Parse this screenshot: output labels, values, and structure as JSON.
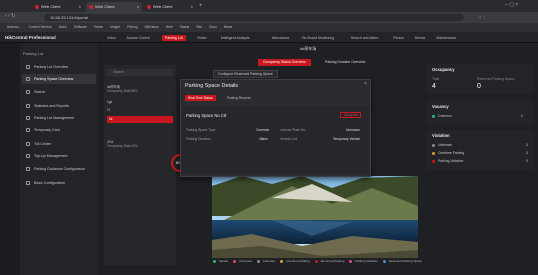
{
  "browser": {
    "tabs": [
      {
        "label": "Web Client"
      },
      {
        "label": "Web Client"
      },
      {
        "label": "Web Client"
      }
    ],
    "url": "10.66.25.131/#/portal",
    "bookmarks": [
      "Arduino...",
      "Control Service",
      "Dash",
      "Software",
      "Home",
      "Insight",
      "Pairing",
      "HikVision",
      "Web",
      "Status",
      "Site",
      "Docs",
      "News"
    ]
  },
  "app": {
    "logo": "HikCentral Professional",
    "menu": [
      "Video",
      "Access Control",
      "Parking Lot",
      "Visitor",
      "Intelligent Analysis",
      "Attendance",
      "On-Board Monitoring",
      "Search and Alarm",
      "Person",
      "Device",
      "Maintenance"
    ],
    "active_menu": "Parking Lot"
  },
  "sidebar": {
    "header": "Parking Lot",
    "items": [
      {
        "label": "Parking Lot Overview"
      },
      {
        "label": "Parking Space Overview"
      },
      {
        "label": "Search"
      },
      {
        "label": "Statistics and Reports"
      },
      {
        "label": "Parking Lot Management"
      },
      {
        "label": "Temporary Card"
      },
      {
        "label": "Toll Center"
      },
      {
        "label": "Top-Up Management"
      },
      {
        "label": "Parking Guidance Configuration"
      },
      {
        "label": "Basic Configuration"
      }
    ]
  },
  "main": {
    "breadcrumb": "lot停车场",
    "tabs": [
      "Occupancy Status Overview",
      "Parking Duration Overview"
    ],
    "search_placeholder": "Search",
    "lots": [
      {
        "name": "lot停车场",
        "sub": "Occupancy Rate 80%"
      },
      {
        "name": "1ge",
        "sub": ""
      },
      {
        "name": "1f",
        "sub": ""
      },
      {
        "name": "lot",
        "sub": ""
      },
      {
        "name": "2/04",
        "sub": "Occupancy Rate 40%"
      }
    ],
    "config_button": "Configure Reserved Parking Space",
    "gauge_value": "80%",
    "legend": [
      "Vacant",
      "Occupied",
      "Unknown",
      "Overtime Parking",
      "Abnormal Parking",
      "Parking Violation",
      "Reserved Parking Space"
    ]
  },
  "right": {
    "occupancy_title": "Occupancy",
    "total_label": "Total",
    "total_value": "4",
    "reserved_label": "Reserved Parking Space",
    "reserved_value": "0",
    "vacancy_title": "Vacancy",
    "common_label": "Common",
    "common_value": "2",
    "violation_title": "Violation",
    "violation_rows": [
      {
        "label": "Unknown",
        "value": "0"
      },
      {
        "label": "Overtime Parking",
        "value": "0"
      },
      {
        "label": "Parking Violation",
        "value": "0"
      }
    ]
  },
  "modal": {
    "title": "Parking Space Details",
    "tabs": [
      "Real-Time Status",
      "Parking Records"
    ],
    "space_name": "Parking Space No.C8",
    "status": "Occupied",
    "fields": [
      {
        "label": "Parking Space Type",
        "value": "Common"
      },
      {
        "label": "License Plate No.",
        "value": "Unknown"
      },
      {
        "label": "Parking Duration",
        "value": "48sec"
      },
      {
        "label": "Vehicle List",
        "value": "Temporary Vehicle"
      }
    ]
  },
  "colors": {
    "accent": "#c8171e",
    "bg": "#1b1c1f",
    "panel": "#232427"
  }
}
